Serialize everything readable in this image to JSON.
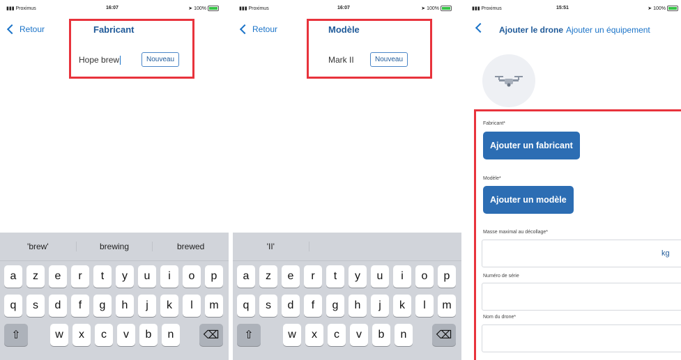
{
  "colors": {
    "accent": "#1f5a99",
    "link": "#1a73c8",
    "highlight": "#e8333c",
    "primary_button": "#2c6db3"
  },
  "screens": [
    {
      "status": {
        "carrier": "Proximus",
        "time": "16:07",
        "battery": "100%"
      },
      "back_label": "Retour",
      "title": "Fabricant",
      "field_value": "Hope brew",
      "new_button": "Nouveau",
      "suggestions": [
        "'brew'",
        "brewing",
        "brewed"
      ],
      "rows": [
        [
          "a",
          "z",
          "e",
          "r",
          "t",
          "y",
          "u",
          "i",
          "o",
          "p"
        ],
        [
          "q",
          "s",
          "d",
          "f",
          "g",
          "h",
          "j",
          "k",
          "l",
          "m"
        ],
        [
          "w",
          "x",
          "c",
          "v",
          "b",
          "n"
        ]
      ]
    },
    {
      "status": {
        "carrier": "Proximus",
        "time": "16:07",
        "battery": "100%"
      },
      "back_label": "Retour",
      "title": "Modèle",
      "field_value": "Mark II",
      "new_button": "Nouveau",
      "suggestions": [
        "'II'",
        "",
        ""
      ],
      "rows": [
        [
          "a",
          "z",
          "e",
          "r",
          "t",
          "y",
          "u",
          "i",
          "o",
          "p"
        ],
        [
          "q",
          "s",
          "d",
          "f",
          "g",
          "h",
          "j",
          "k",
          "l",
          "m"
        ],
        [
          "w",
          "x",
          "c",
          "v",
          "b",
          "n"
        ]
      ]
    },
    {
      "status": {
        "carrier": "Proximus",
        "time": "15:51",
        "battery": "100%"
      },
      "title": "Ajouter le drone",
      "subtitle_link": "Ajouter un équipement",
      "avatar_icon": "drone-icon",
      "form": {
        "manufacturer_label": "Fabricant*",
        "manufacturer_button": "Ajouter un fabricant",
        "model_label": "Modèle*",
        "model_button": "Ajouter un modèle",
        "mass_label": "Masse maximal au décollage*",
        "mass_unit": "kg",
        "serial_label": "Numéro de série",
        "name_label": "Nom du drone*"
      }
    }
  ],
  "icons": {
    "shift": "⇧",
    "delete": "⌫"
  }
}
